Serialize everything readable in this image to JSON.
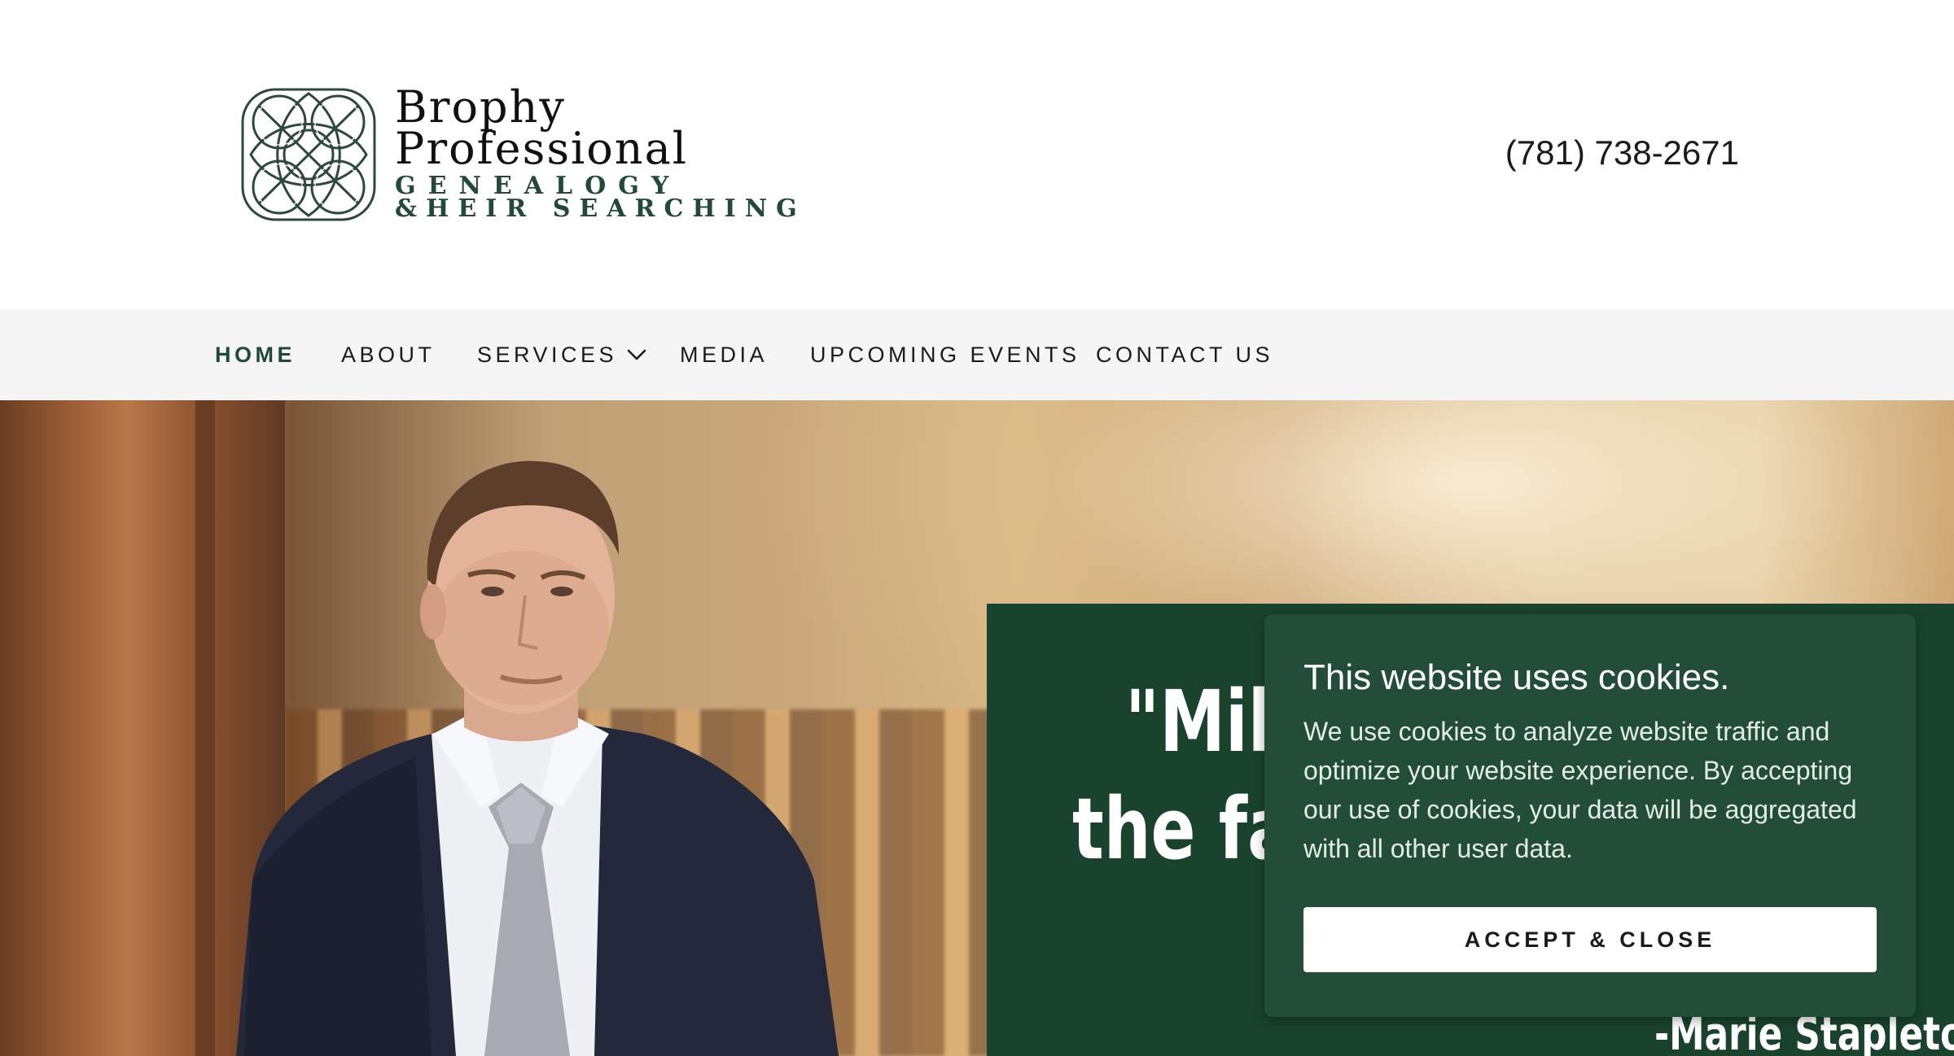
{
  "header": {
    "logo": {
      "line1": "Brophy",
      "line2": "Professional",
      "line3": "GENEALOGY",
      "line4": "&HEIR SEARCHING",
      "icon": "celtic-knot-icon"
    },
    "phone": "(781) 738-2671"
  },
  "nav": {
    "items": [
      {
        "label": "HOME",
        "active": true
      },
      {
        "label": "ABOUT"
      },
      {
        "label": "SERVICES",
        "icon": "chevron-down-icon"
      },
      {
        "label": "MEDIA"
      },
      {
        "label": "UPCOMING EVENTS"
      },
      {
        "label": "CONTACT US"
      }
    ]
  },
  "hero": {
    "quote_line1": "\"Mik",
    "quote_line2": "the fa",
    "quote_line3": "\"",
    "quote_attribution": "-Marie Stapleton"
  },
  "cookie_banner": {
    "title": "This website uses cookies.",
    "body": "We use cookies to analyze website traffic and optimize your website experience. By accepting our use of cookies, your data will be aggregated with all other user data.",
    "accept_label": "ACCEPT & CLOSE"
  },
  "colors": {
    "brand_green": "#224d38",
    "nav_active": "#1f4b36",
    "nav_background": "#f5f5f5",
    "quote_panel": "#19432c"
  }
}
